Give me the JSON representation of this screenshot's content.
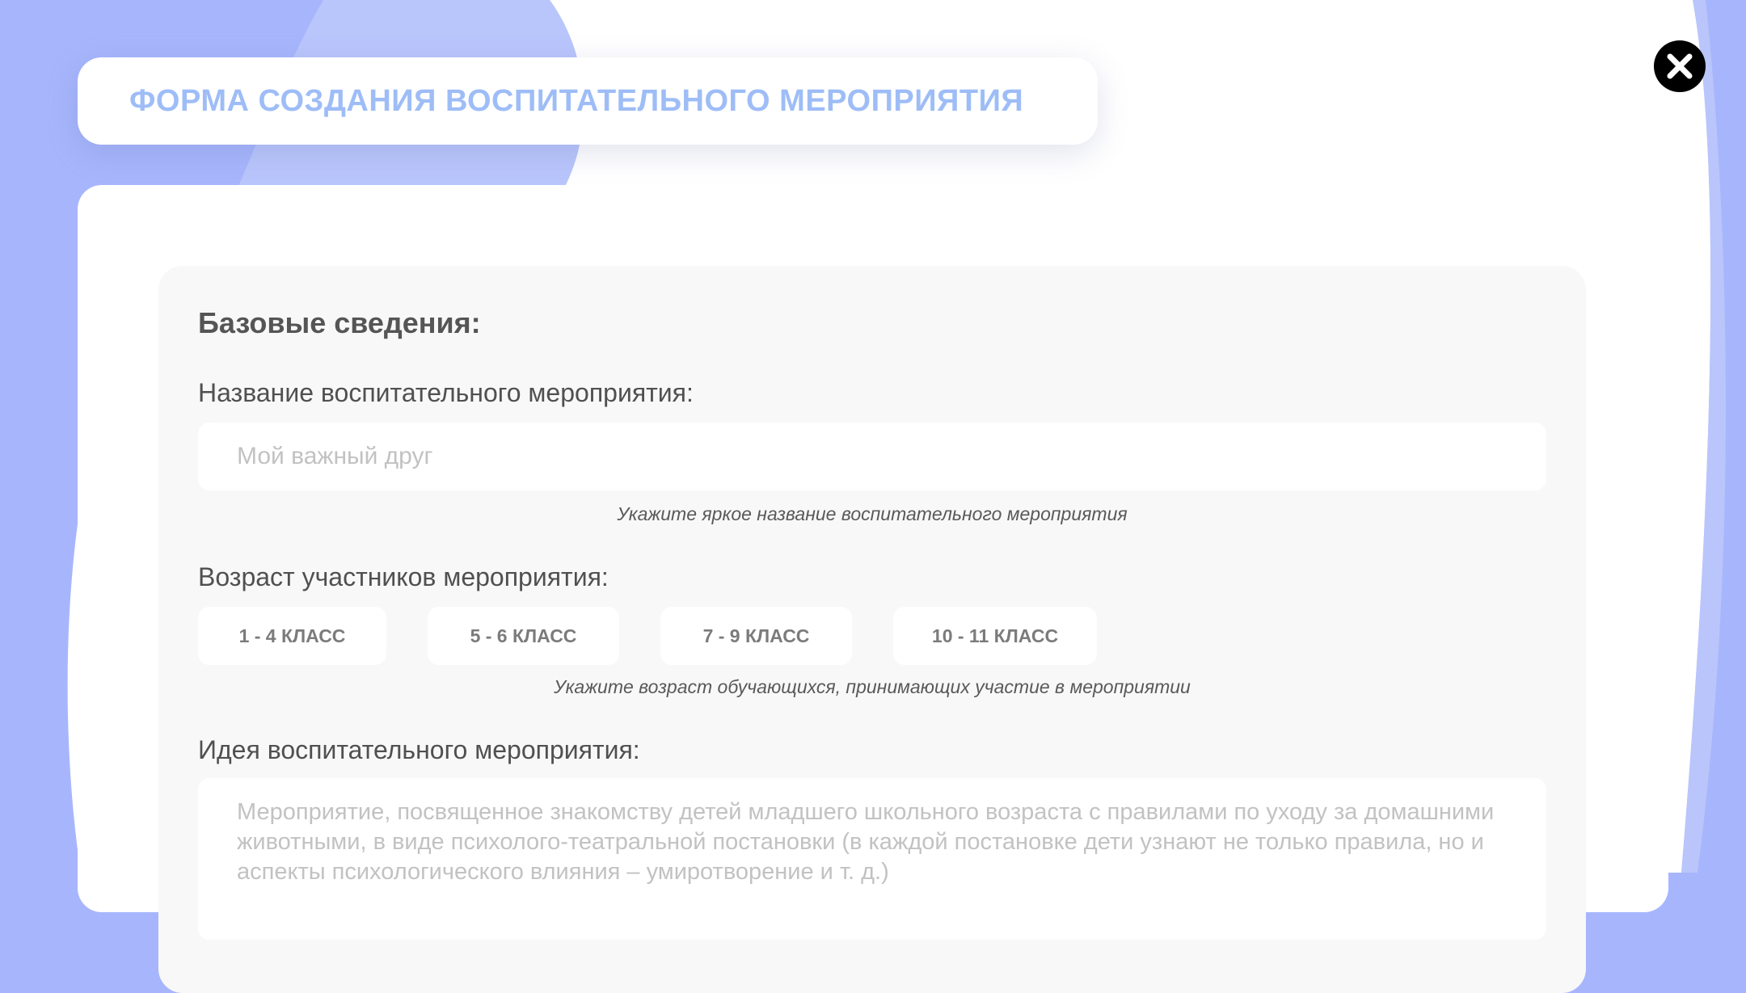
{
  "header": {
    "title": "ФОРМА СОЗДАНИЯ ВОСПИТАТЕЛЬНОГО МЕРОПРИЯТИЯ"
  },
  "icons": {
    "close": "close-icon"
  },
  "colors": {
    "background": "#a7b6fc",
    "title_accent": "#9ebdf7",
    "close_button": "#000000"
  },
  "form": {
    "section_title": "Базовые сведения:",
    "event_name": {
      "label": "Название воспитательного мероприятия:",
      "placeholder": "Мой важный друг",
      "hint": "Укажите яркое название воспитательного мероприятия"
    },
    "age": {
      "label": "Возраст участников мероприятия:",
      "options": [
        "1 - 4 КЛАСС",
        "5 - 6 КЛАСС",
        "7 - 9 КЛАСС",
        "10 - 11 КЛАСС"
      ],
      "hint": "Укажите возраст обучающихся, принимающих участие в мероприятии"
    },
    "idea": {
      "label": "Идея воспитательного мероприятия:",
      "placeholder": "Мероприятие, посвященное знакомству детей младшего школьного возраста с правилами по уходу за домашними животными, в виде психолого-театральной постановки (в каждой постановке дети узнают не только правила, но и аспекты психологического влияния – умиротворение и т. д.)"
    }
  }
}
